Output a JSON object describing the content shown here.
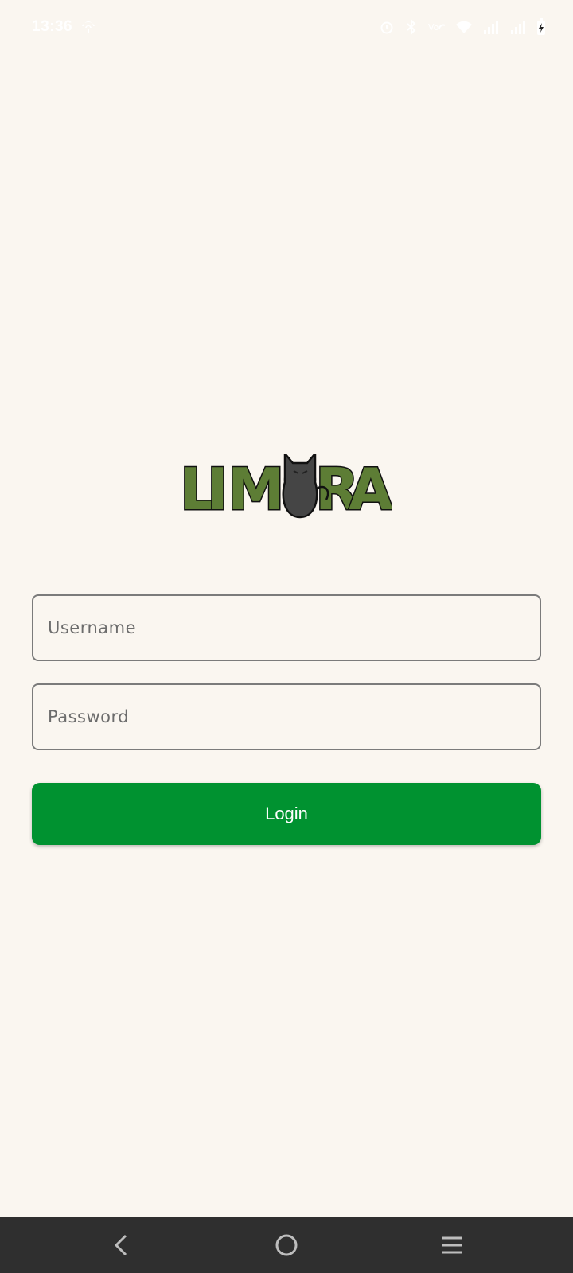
{
  "status_bar": {
    "time": "13:36",
    "icons": [
      "wifi-hotspot-icon",
      "alarm-icon",
      "bluetooth-icon",
      "vo-wifi-icon",
      "wifi-icon",
      "signal-icon",
      "signal-icon",
      "battery-charging-icon"
    ]
  },
  "logo": {
    "text": "LIMURA",
    "letter_color": "#5d7d35",
    "cat_color": "#444444"
  },
  "login_form": {
    "username_placeholder": "Username",
    "password_placeholder": "Password",
    "login_label": "Login",
    "button_color": "#009230"
  },
  "nav_bar": {
    "buttons": [
      "back-icon",
      "home-icon",
      "menu-icon"
    ]
  }
}
